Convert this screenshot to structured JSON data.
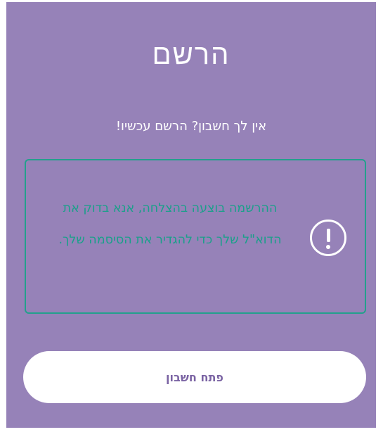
{
  "header": {
    "title": "הרשם",
    "subtitle": "אין לך חשבון? הרשם עכשיו!"
  },
  "notice": {
    "icon": "exclamation-circle-icon",
    "message": "ההרשמה בוצעה בהצלחה, אנא בדוק את הדוא\"ל שלך כדי להגדיר את הסיסמה שלך.",
    "border_color": "#23a08c",
    "text_color": "#1aa08a"
  },
  "actions": {
    "open_account_label": "פתח חשבון"
  },
  "colors": {
    "panel_background": "#9682b8",
    "button_background": "#ffffff",
    "button_text": "#7a63a3"
  }
}
